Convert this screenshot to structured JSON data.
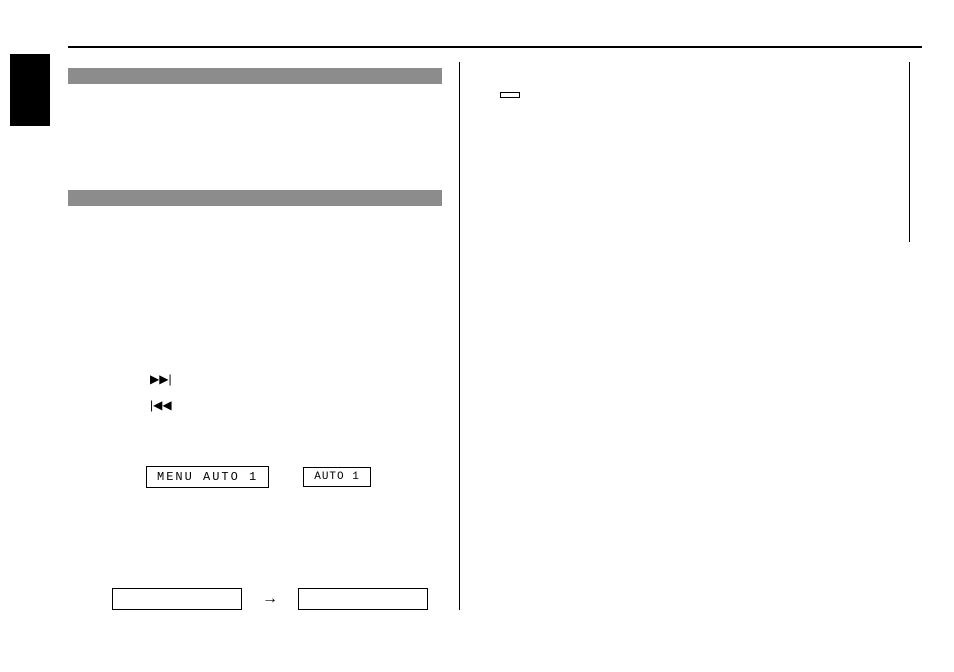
{
  "icons": {
    "next_track": "▶▶|",
    "prev_track": "|◀◀",
    "arrow_right": "→"
  },
  "lcd": {
    "menu_auto": "MENU  AUTO  1",
    "auto_small": "AUTO  1"
  },
  "key": {
    "blank": " "
  }
}
